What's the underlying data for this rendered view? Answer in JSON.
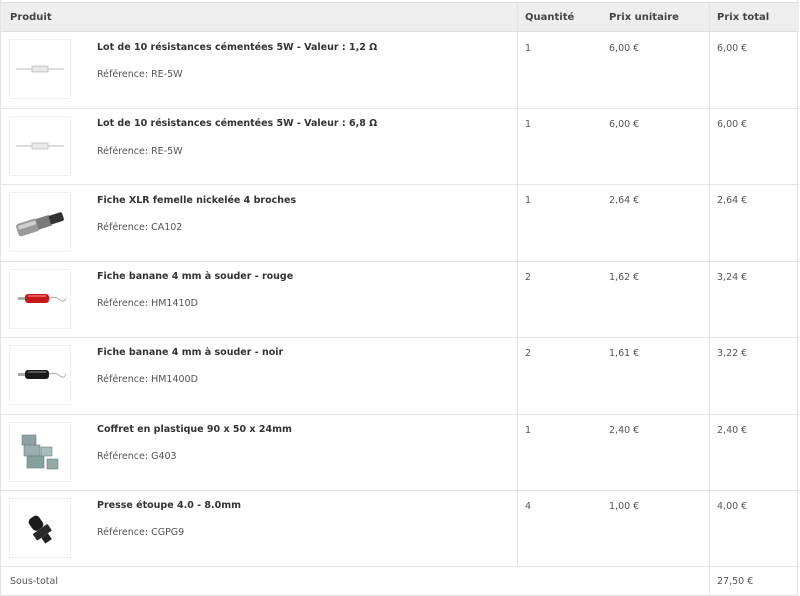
{
  "table": {
    "headers": {
      "product": "Produit",
      "quantity": "Quantité",
      "unit_price": "Prix unitaire",
      "total_price": "Prix total"
    },
    "reference_label": "Référence:",
    "rows": [
      {
        "title": "Lot de 10 résistances cémentées 5W - Valeur : 1,2 Ω",
        "reference": "RE-5W",
        "quantity": "1",
        "unit_price": "6,00 €",
        "total_price": "6,00 €",
        "image_icon": "resistor-icon"
      },
      {
        "title": "Lot de 10 résistances cémentées 5W - Valeur : 6,8 Ω",
        "reference": "RE-5W",
        "quantity": "1",
        "unit_price": "6,00 €",
        "total_price": "6,00 €",
        "image_icon": "resistor-icon"
      },
      {
        "title": "Fiche XLR femelle nickelée 4 broches",
        "reference": "CA102",
        "quantity": "1",
        "unit_price": "2,64 €",
        "total_price": "2,64 €",
        "image_icon": "xlr-connector-icon"
      },
      {
        "title": "Fiche banane 4 mm à souder - rouge",
        "reference": "HM1410D",
        "quantity": "2",
        "unit_price": "1,62 €",
        "total_price": "3,24 €",
        "image_icon": "banana-plug-red-icon"
      },
      {
        "title": "Fiche banane 4 mm à souder - noir",
        "reference": "HM1400D",
        "quantity": "2",
        "unit_price": "1,61 €",
        "total_price": "3,22 €",
        "image_icon": "banana-plug-black-icon"
      },
      {
        "title": "Coffret en plastique 90 x 50 x 24mm",
        "reference": "G403",
        "quantity": "1",
        "unit_price": "2,40 €",
        "total_price": "2,40 €",
        "image_icon": "plastic-box-icon"
      },
      {
        "title": "Presse étoupe 4.0 - 8.0mm",
        "reference": "CGPG9",
        "quantity": "4",
        "unit_price": "1,00 €",
        "total_price": "4,00 €",
        "image_icon": "cable-gland-icon"
      }
    ],
    "subtotal": {
      "label": "Sous-total",
      "value": "27,50 €"
    }
  },
  "colors": {
    "header_bg": "#eeeeee",
    "border": "#e4e4e4",
    "text": "#333333"
  }
}
